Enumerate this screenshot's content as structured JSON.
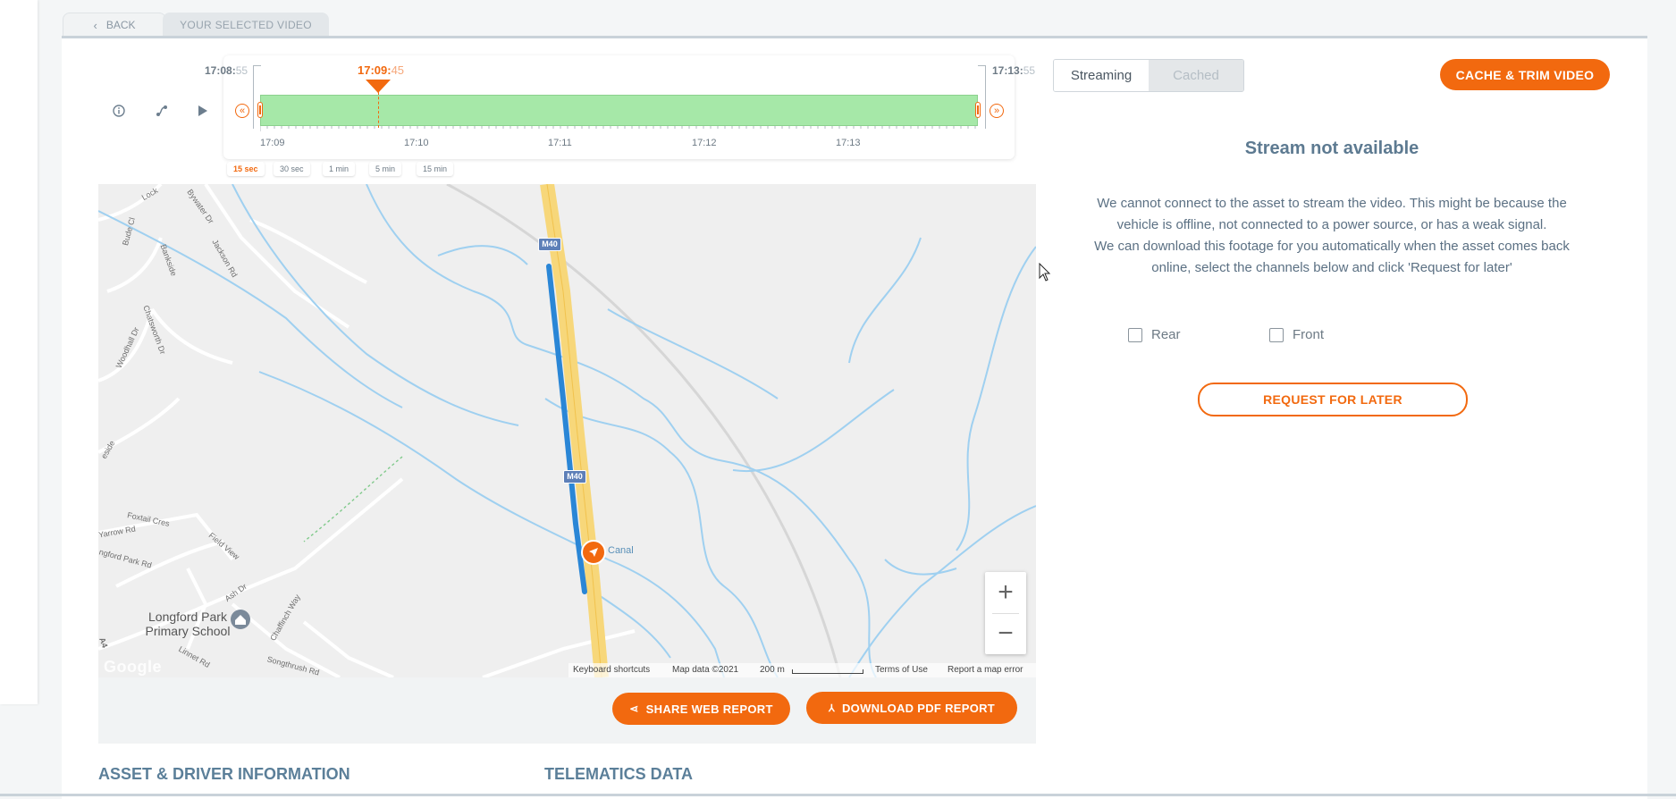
{
  "tabs": {
    "back": "BACK",
    "selected": "YOUR SELECTED VIDEO"
  },
  "timeline": {
    "start_time": "17:08:",
    "start_sec": "55",
    "end_time": "17:13:",
    "end_sec": "55",
    "current_time": "17:09:",
    "current_sec": "45",
    "tick_labels": [
      "17:09",
      "17:10",
      "17:11",
      "17:12",
      "17:13"
    ],
    "scales": [
      "15 sec",
      "30 sec",
      "1 min",
      "5 min",
      "15 min"
    ],
    "active_scale": "15 sec",
    "rewind_glyph": "«",
    "forward_glyph": "»"
  },
  "controls": {
    "info_icon": "info-icon",
    "route_icon": "route-icon",
    "play_icon": "play-icon"
  },
  "map": {
    "labels": [
      "Lock",
      "Bywater Dr",
      "Bude Cl",
      "Banksidе",
      "Jackson Rd",
      "Woodhall Dr",
      "Chatsworth Dr",
      "eside",
      "Foxtail Cres",
      "Field View",
      "Yarrow Rd",
      "ngford Park Rd",
      "Ash Dr",
      "Chaffinch Way",
      "Linnet Rd",
      "Songthrush Rd",
      "Canal",
      "A4"
    ],
    "road_badges": [
      "M40",
      "M40"
    ],
    "poi": "Longford Park Primary School",
    "watermark": "Google",
    "attribution": {
      "shortcuts": "Keyboard shortcuts",
      "data": "Map data ©2021",
      "scale": "200 m",
      "terms": "Terms of Use",
      "report": "Report a map error"
    },
    "zoom_in": "+",
    "zoom_out": "−"
  },
  "buttons": {
    "share": "SHARE WEB REPORT",
    "download": "DOWNLOAD PDF REPORT",
    "cache": "CACHE & TRIM VIDEO",
    "request": "REQUEST FOR LATER"
  },
  "toggle": {
    "streaming": "Streaming",
    "cached": "Cached"
  },
  "stream": {
    "title": "Stream not available",
    "line1": "We cannot connect to the asset to stream the video. This might be because the",
    "line2": "vehicle is offline, not connected to a power source, or has a weak signal.",
    "line3": "We can download this footage for you automatically when the asset comes back",
    "line4": "online, select the channels below and click 'Request for later'"
  },
  "channels": {
    "rear": "Rear",
    "front": "Front"
  },
  "sections": {
    "asset": "ASSET & DRIVER INFORMATION",
    "telematics": "TELEMATICS DATA"
  },
  "colors": {
    "accent": "#f2690f",
    "timeline_fill": "#a6e8a8",
    "route": "#2a86d6",
    "motorway": "#f7d77a",
    "water": "#9fd0f0"
  }
}
